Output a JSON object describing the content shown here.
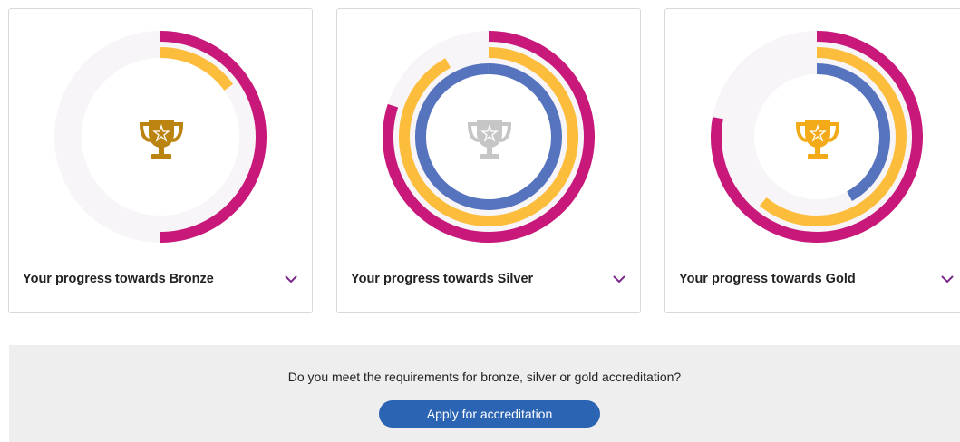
{
  "colors": {
    "track": "#f7f5f7",
    "magenta": "#c8197a",
    "yellow": "#fdbd3c",
    "blue": "#5674bd",
    "bronze_trophy": "#bb8410",
    "silver_trophy": "#c6c6c6",
    "gold_trophy": "#f2aa18",
    "chevron": "#7b2a8c",
    "button": "#2b64b3"
  },
  "cards": [
    {
      "title": "Your progress towards Bronze",
      "trophy_icon": "trophy-bronze-icon",
      "rings": [
        {
          "color": "magenta",
          "progress": 0.5
        },
        {
          "color": "yellow",
          "progress": 0.15
        }
      ]
    },
    {
      "title": "Your progress towards Silver",
      "trophy_icon": "trophy-silver-icon",
      "rings": [
        {
          "color": "magenta",
          "progress": 0.8
        },
        {
          "color": "yellow",
          "progress": 0.92
        },
        {
          "color": "blue",
          "progress": 1.0
        }
      ]
    },
    {
      "title": "Your progress towards Gold",
      "trophy_icon": "trophy-gold-icon",
      "rings": [
        {
          "color": "magenta",
          "progress": 0.78
        },
        {
          "color": "yellow",
          "progress": 0.61
        },
        {
          "color": "blue",
          "progress": 0.42
        }
      ]
    }
  ],
  "banner": {
    "question": "Do you meet the requirements for bronze, silver or gold accreditation?",
    "button_label": "Apply for accreditation"
  }
}
